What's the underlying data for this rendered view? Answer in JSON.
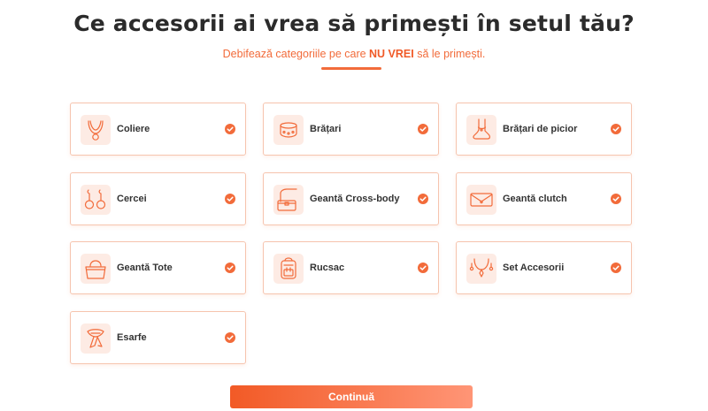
{
  "page": {
    "title": "Ce accesorii ai vrea să primești în setul tău?",
    "subtitle_before": "Debifează categoriile pe care ",
    "subtitle_bold": "NU VREI",
    "subtitle_after": " să le primești.",
    "continue_label": "Continuă"
  },
  "colors": {
    "accent": "#f26b3a",
    "card_border": "#f6c4ae",
    "icon_bg": "#fdebe4",
    "title": "#2b2b2b"
  },
  "categories": [
    {
      "label": "Coliere",
      "icon": "necklace-icon",
      "checked": true
    },
    {
      "label": "Brățari",
      "icon": "bracelet-icon",
      "checked": true
    },
    {
      "label": "Brățari de picior",
      "icon": "anklet-icon",
      "checked": true
    },
    {
      "label": "Cercei",
      "icon": "earrings-icon",
      "checked": true
    },
    {
      "label": "Geantă Cross-body",
      "icon": "crossbody-bag-icon",
      "checked": true
    },
    {
      "label": "Geantă clutch",
      "icon": "clutch-bag-icon",
      "checked": true
    },
    {
      "label": "Geantă Tote",
      "icon": "tote-bag-icon",
      "checked": true
    },
    {
      "label": "Rucsac",
      "icon": "backpack-icon",
      "checked": true
    },
    {
      "label": "Set Accesorii",
      "icon": "accessory-set-icon",
      "checked": true
    },
    {
      "label": "Esarfe",
      "icon": "scarf-icon",
      "checked": true
    }
  ]
}
